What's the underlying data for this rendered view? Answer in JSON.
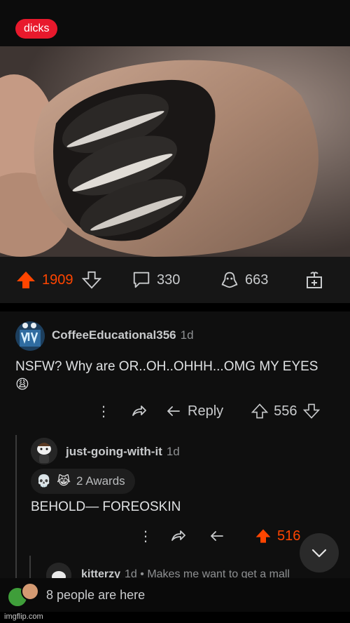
{
  "post": {
    "flair": "dicks",
    "flair_color": "#e8192c",
    "image_alt": "photo of a fist holding stacked sandwich cookies",
    "upvotes": "1909",
    "comments": "330",
    "awards": "663",
    "accent_color": "#ff4500"
  },
  "comments": [
    {
      "username": "CoffeeEducational356",
      "age": "1d",
      "text": "NSFW? Why are OR..OH..OHHH...OMG MY EYES",
      "emoji": "😩",
      "reply_label": "Reply",
      "votes": "556"
    },
    {
      "username": "just-going-with-it",
      "age": "1d",
      "awards_label": "2 Awards",
      "text": "BEHOLD— FOREOSKIN",
      "votes": "516"
    },
    {
      "username": "kitterzy",
      "age": "1d",
      "text": "Makes me want to get a mall"
    }
  ],
  "presence": {
    "label": "8 people are here"
  },
  "watermark": "imgflip.com"
}
